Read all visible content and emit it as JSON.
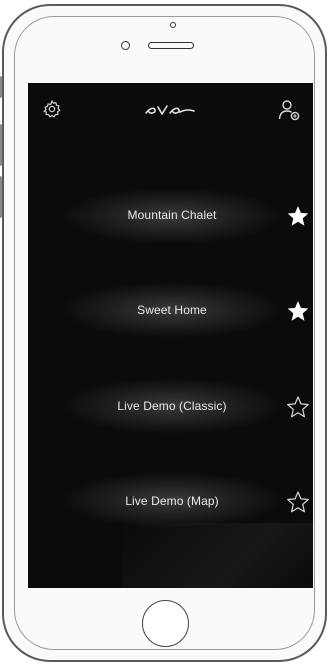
{
  "app": {
    "logo_text": "eve"
  },
  "header": {
    "settings_icon": "gear-icon",
    "account_icon": "account-icon"
  },
  "homes": [
    {
      "label": "Mountain Chalet",
      "favorite": true
    },
    {
      "label": "Sweet Home",
      "favorite": true
    },
    {
      "label": "Live Demo (Classic)",
      "favorite": false
    },
    {
      "label": "Live Demo (Map)",
      "favorite": false
    }
  ],
  "colors": {
    "screen_bg": "#0b0b0b",
    "text": "#e9e9e9",
    "icon": "#d8d8d8"
  }
}
